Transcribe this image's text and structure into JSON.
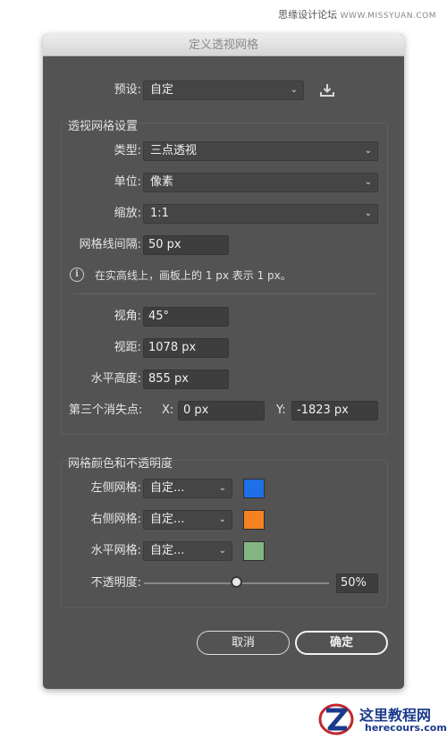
{
  "watermark_top": {
    "text": "思缘设计论坛",
    "site": "WWW.MISSYUAN.COM"
  },
  "dialog": {
    "title": "定义透视网格",
    "preset": {
      "label": "预设:",
      "value": "自定"
    },
    "grid_settings": {
      "title": "透视网格设置",
      "type": {
        "label": "类型:",
        "value": "三点透视"
      },
      "unit": {
        "label": "单位:",
        "value": "像素"
      },
      "scale": {
        "label": "缩放:",
        "value": "1:1"
      },
      "gridline": {
        "label": "网格线间隔:",
        "value": "50 px"
      },
      "info": "在实高线上，画板上的 1 px 表示 1 px。",
      "view_angle": {
        "label": "视角:",
        "value": "45°"
      },
      "view_distance": {
        "label": "视距:",
        "value": "1078 px"
      },
      "horizon_height": {
        "label": "水平高度:",
        "value": "855 px"
      },
      "third_vp": {
        "label": "第三个消失点:",
        "x_label": "X:",
        "x_value": "0 px",
        "y_label": "Y:",
        "y_value": "-1823 px"
      }
    },
    "color_opacity": {
      "title": "网格颜色和不透明度",
      "left_grid": {
        "label": "左侧网格:",
        "value": "自定...",
        "color": "#1f6fe6"
      },
      "right_grid": {
        "label": "右侧网格:",
        "value": "自定...",
        "color": "#f58220"
      },
      "horizontal_grid": {
        "label": "水平网格:",
        "value": "自定...",
        "color": "#86b584"
      },
      "opacity": {
        "label": "不透明度:",
        "value": "50%",
        "fraction": 0.5
      }
    },
    "buttons": {
      "cancel": "取消",
      "ok": "确定"
    }
  },
  "watermark_bottom": {
    "cn": "这里教程网",
    "en": "herecours.com"
  }
}
